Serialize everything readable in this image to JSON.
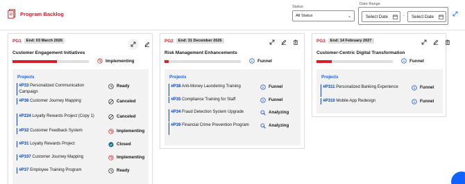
{
  "page": {
    "title": "Program Backlog"
  },
  "filters": {
    "status_label": "Status",
    "status_value": "All Status",
    "date_range_label": "Date Range",
    "start_placeholder": "Select Date",
    "separator": "-",
    "end_placeholder": "Select Date"
  },
  "colors": {
    "accent": "#da1e28",
    "link": "#0f62fe",
    "bar": "#0043ce",
    "panel": "#f2f2f2"
  },
  "programs": [
    {
      "id": "PG1",
      "end_date": "End: 03 March 2026",
      "name": "Customer Engagement Initiatives",
      "status": "Implementing",
      "status_icon": "implementing-icon",
      "progress": 0.58,
      "projects_label": "Projects",
      "projects": [
        {
          "code": "#P33",
          "name": " Personalized Communication Campaign",
          "status": "Ready",
          "icon": "ready-icon"
        },
        {
          "code": "#P36",
          "name": " Customer Journey Mapping",
          "status": "Canceled",
          "icon": "canceled-icon"
        },
        {
          "code": "#P224",
          "name": " Loyalty Rewards Project (Copy 1)",
          "status": "Canceled",
          "icon": "canceled-icon"
        },
        {
          "code": "#P32",
          "name": " Customer Feedback System",
          "status": "Implementing",
          "icon": "implementing-icon"
        },
        {
          "code": "#P31",
          "name": " Loyalty Rewards Project",
          "status": "Closed",
          "icon": "closed-icon"
        },
        {
          "code": "#P337",
          "name": " Customer Journey Mapping",
          "status": "Implementing",
          "icon": "implementing-icon"
        },
        {
          "code": "#P37",
          "name": " Employee Training Program",
          "status": "Ready",
          "icon": "ready-icon"
        }
      ]
    },
    {
      "id": "PG2",
      "end_date": "End: 31 December 2026",
      "name": "Risk Management Enhancements",
      "status": "Funnel",
      "status_icon": "funnel-icon",
      "progress": 0.05,
      "projects_label": "Projects",
      "projects": [
        {
          "code": "#P38",
          "name": " Anti-Money Laundering Training",
          "status": "Funnel",
          "icon": "funnel-icon"
        },
        {
          "code": "#P35",
          "name": " Compliance Training for Staff",
          "status": "Funnel",
          "icon": "funnel-icon"
        },
        {
          "code": "#P34",
          "name": " Fraud Detection System Upgrade",
          "status": "Analyzing",
          "icon": "analyzing-icon"
        },
        {
          "code": "#P39",
          "name": " Financial Crime Prevention Program",
          "status": "Analyzing",
          "icon": "analyzing-icon"
        }
      ]
    },
    {
      "id": "PG3",
      "end_date": "End: 14 February 2027",
      "name": "Customer-Centric Digital Transformation",
      "status": "Funnel",
      "status_icon": "funnel-icon",
      "progress": 0.2,
      "projects_label": "Projects",
      "projects": [
        {
          "code": "#P311",
          "name": " Personalized Banking Experience",
          "status": "Funnel",
          "icon": "funnel-icon"
        },
        {
          "code": "#P310",
          "name": " Mobile App Redesign",
          "status": "Funnel",
          "icon": "funnel-icon"
        }
      ]
    }
  ]
}
